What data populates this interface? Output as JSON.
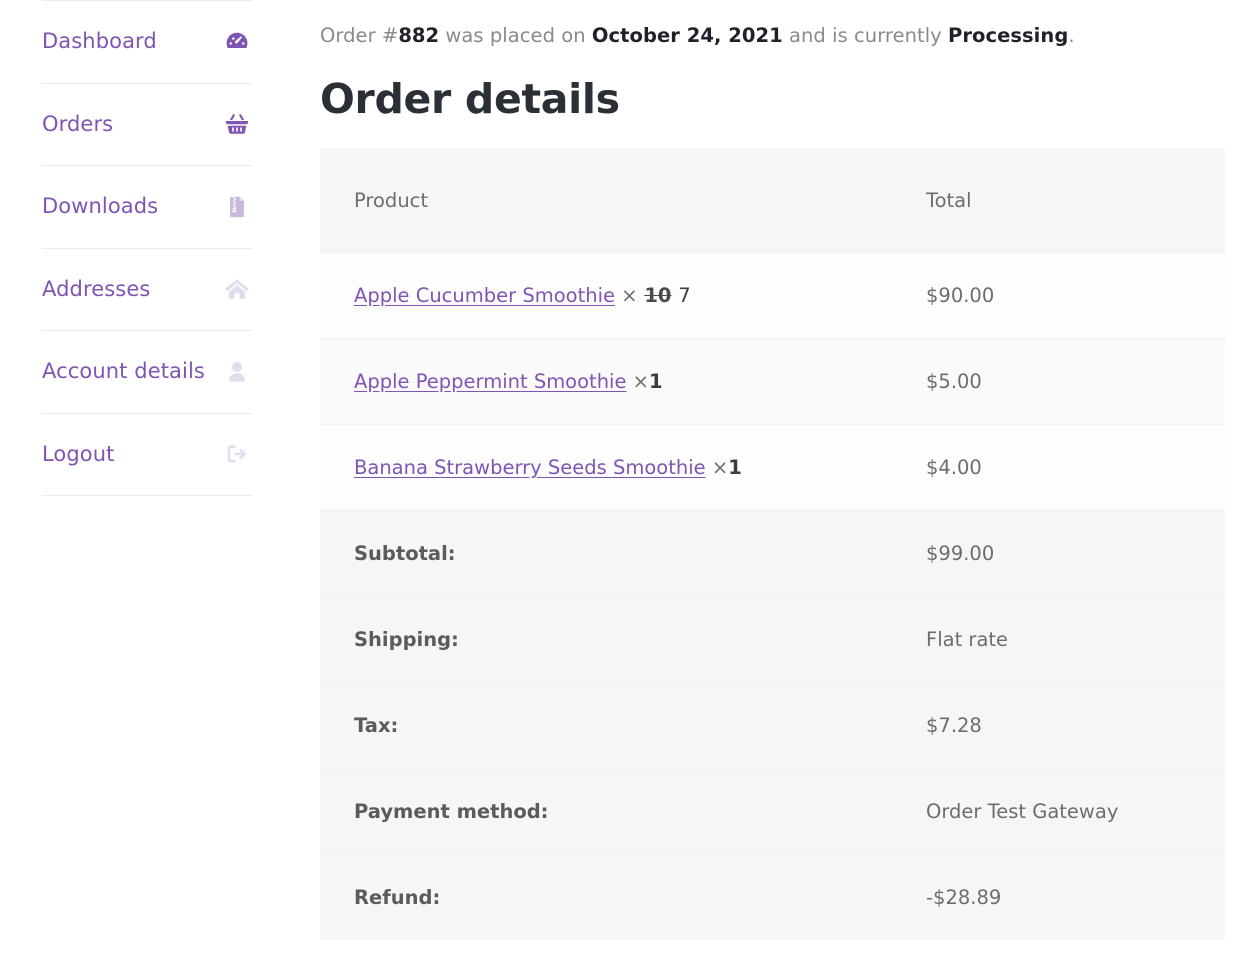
{
  "sidebar": {
    "items": [
      {
        "label": "Dashboard",
        "icon": "tachometer-icon",
        "icon_tone": "strong"
      },
      {
        "label": "Orders",
        "icon": "shopping-basket-icon",
        "icon_tone": "strong"
      },
      {
        "label": "Downloads",
        "icon": "file-archive-icon",
        "icon_tone": "muted"
      },
      {
        "label": "Addresses",
        "icon": "home-icon",
        "icon_tone": "faint"
      },
      {
        "label": "Account details",
        "icon": "user-icon",
        "icon_tone": "faint"
      },
      {
        "label": "Logout",
        "icon": "sign-out-icon",
        "icon_tone": "faint"
      }
    ]
  },
  "order_status": {
    "prefix": "Order #",
    "order_number": "882",
    "placed_on_text": " was placed on ",
    "date": "October 24, 2021",
    "middle_text": " and is currently ",
    "status": "Processing",
    "suffix": "."
  },
  "main": {
    "page_title": "Order details"
  },
  "table": {
    "headers": {
      "product": "Product",
      "total": "Total"
    },
    "items": [
      {
        "name": "Apple Cucumber Smoothie",
        "times": "×",
        "qty_old": "10",
        "qty_new": "7",
        "total": "$90.00"
      },
      {
        "name": "Apple Peppermint Smoothie",
        "times": "×",
        "qty_old": "",
        "qty_new": "1",
        "total": "$5.00"
      },
      {
        "name": "Banana Strawberry Seeds Smoothie",
        "times": "×",
        "qty_old": "",
        "qty_new": "1",
        "total": "$4.00"
      }
    ],
    "summary": [
      {
        "label": "Subtotal:",
        "value": "$99.00"
      },
      {
        "label": "Shipping:",
        "value": "Flat rate"
      },
      {
        "label": "Tax:",
        "value": "$7.28"
      },
      {
        "label": "Payment method:",
        "value": "Order Test Gateway"
      },
      {
        "label": "Refund:",
        "value": "-$28.89"
      }
    ]
  },
  "colors": {
    "accent_purple": "#7f54b3",
    "icon_muted": "#c9b8dd",
    "icon_faint": "#e3dced",
    "text_body": "#6d6d6d",
    "text_dark": "#2b2f36",
    "table_header_bg": "#f6f6f6",
    "row_bg_odd": "#fdfdfd",
    "row_bg_even": "#fafafa",
    "divider": "#ebebeb"
  }
}
